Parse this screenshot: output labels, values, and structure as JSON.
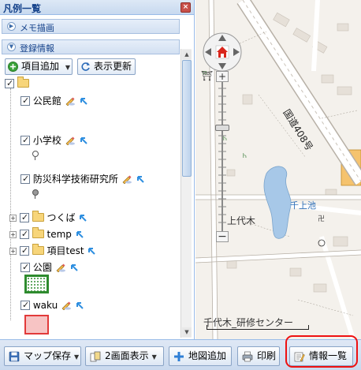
{
  "legend_panel": {
    "title": "凡例一覧",
    "close_symbol": "×",
    "sections": {
      "memo": "メモ描画",
      "registered": "登録情報"
    },
    "toolbar": {
      "add_item": "項目追加",
      "refresh": "表示更新"
    },
    "tree": {
      "items": [
        {
          "label": "公民館",
          "checked": true
        },
        {
          "label": "小学校",
          "checked": true
        },
        {
          "label": "防災科学技術研究所",
          "checked": true
        },
        {
          "label": "つくば",
          "checked": true
        },
        {
          "label": "temp",
          "checked": true
        },
        {
          "label": "項目test",
          "checked": true
        },
        {
          "label": "公園",
          "checked": true
        },
        {
          "label": "waku",
          "checked": true
        }
      ]
    },
    "swatches": {
      "park_border": "#2e8b2e",
      "waku_fill": "#f7c4c4",
      "waku_border": "#e23a3a"
    }
  },
  "map": {
    "labels": {
      "route": "国道408号",
      "pond": "千上池",
      "area": "上代木",
      "facility": "千代木_研修センター"
    },
    "colors": {
      "water": "#a7c8e8",
      "road_main": "#ffffff",
      "building": "#e6e0d8",
      "school": "#f5c36e"
    }
  },
  "bottom_toolbar": {
    "save_map": "マップ保存",
    "dual_view": "2画面表示",
    "add_map": "地図追加",
    "print": "印刷",
    "info_list": "情報一覧"
  }
}
